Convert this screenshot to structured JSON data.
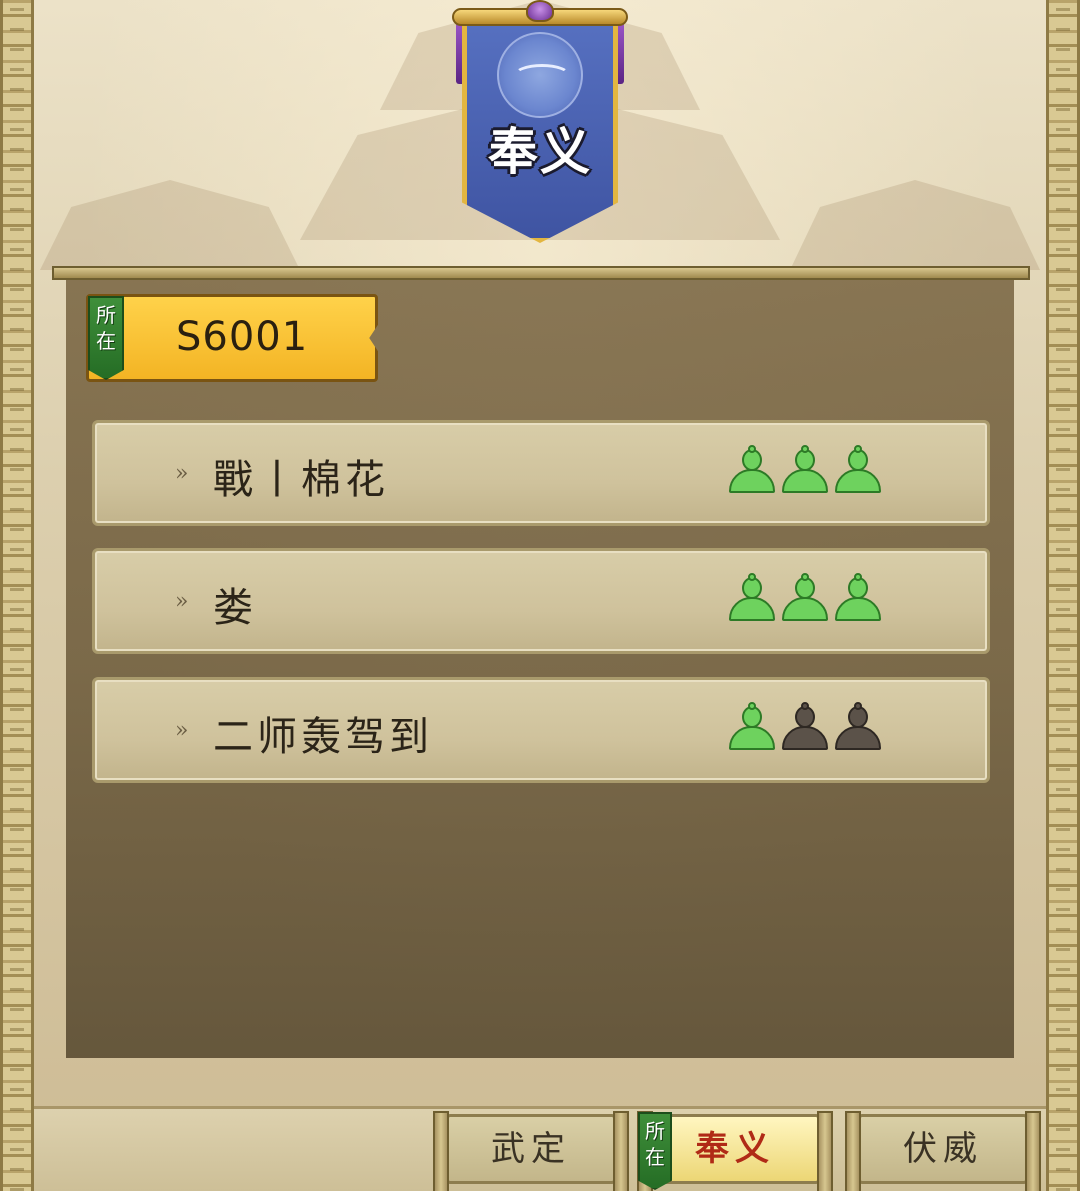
{
  "banner": {
    "title": "奉义",
    "emblem": "crane-emblem-icon"
  },
  "server": {
    "badge": "所在",
    "name": "S6001"
  },
  "teams": [
    {
      "name": "戰丨棉花",
      "filled": 3,
      "capacity": 3
    },
    {
      "name": "娄",
      "filled": 3,
      "capacity": 3
    },
    {
      "name": "二师轰驾到",
      "filled": 1,
      "capacity": 3
    }
  ],
  "tabs": [
    {
      "label": "武定",
      "active": false
    },
    {
      "label": "奉义",
      "active": true,
      "badge": "所在"
    },
    {
      "label": "伏威",
      "active": false
    }
  ],
  "colors": {
    "banner_blue": "#4a5fb0",
    "gold": "#f3b424",
    "member_active": "#6ed25e",
    "member_empty": "#5b5249",
    "active_tab_text": "#b02a16",
    "location_badge": "#2f7a2c"
  }
}
